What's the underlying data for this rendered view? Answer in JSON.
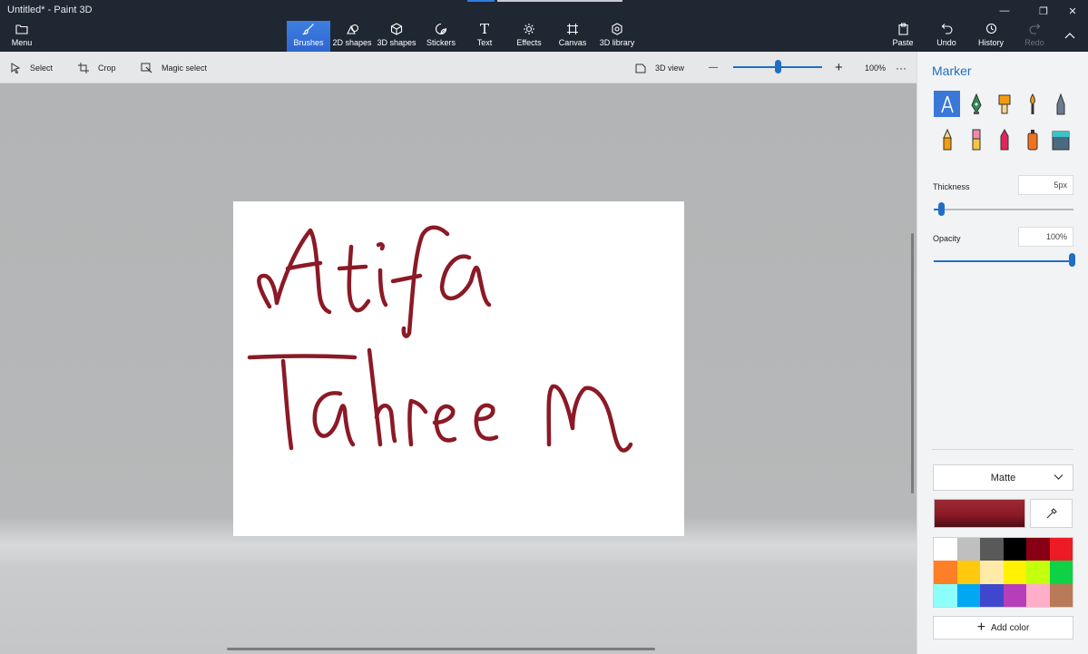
{
  "window": {
    "title": "Untitled* - Paint 3D",
    "minimize_glyph": "—",
    "restore_glyph": "❐",
    "close_glyph": "✕"
  },
  "ribbon": {
    "menu_label": "Menu",
    "tabs": [
      {
        "label": "Brushes",
        "icon": "brush-icon",
        "active": true
      },
      {
        "label": "2D shapes",
        "icon": "2d-shapes-icon"
      },
      {
        "label": "3D shapes",
        "icon": "3d-shapes-icon"
      },
      {
        "label": "Stickers",
        "icon": "stickers-icon"
      },
      {
        "label": "Text",
        "icon": "text-icon",
        "glyph": "T"
      },
      {
        "label": "Effects",
        "icon": "effects-icon"
      },
      {
        "label": "Canvas",
        "icon": "canvas-icon"
      },
      {
        "label": "3D library",
        "icon": "3d-library-icon"
      }
    ],
    "right": [
      {
        "label": "Paste",
        "icon": "paste-icon"
      },
      {
        "label": "Undo",
        "icon": "undo-icon"
      },
      {
        "label": "History",
        "icon": "history-icon"
      },
      {
        "label": "Redo",
        "icon": "redo-icon",
        "disabled": true
      }
    ]
  },
  "toolbar": {
    "select_label": "Select",
    "crop_label": "Crop",
    "magic_select_label": "Magic select",
    "view_3d_label": "3D view",
    "zoom_minus": "—",
    "zoom_plus": "+",
    "zoom_level": "100%",
    "zoom_slider_fraction": 0.5,
    "more_glyph": "···"
  },
  "canvas": {
    "stroke_color": "#8b1a26",
    "drawing_text": [
      "Atifa",
      "Tahreem"
    ]
  },
  "panel": {
    "title": "Marker",
    "brushes": [
      {
        "name": "marker",
        "selected": true
      },
      {
        "name": "calligraphy-pen"
      },
      {
        "name": "oil-brush"
      },
      {
        "name": "watercolor"
      },
      {
        "name": "pixel-pen"
      },
      {
        "name": "pencil"
      },
      {
        "name": "eraser"
      },
      {
        "name": "crayon"
      },
      {
        "name": "spray-can"
      },
      {
        "name": "fill"
      }
    ],
    "thickness_label": "Thickness",
    "thickness_value": "5px",
    "thickness_fraction": 0.05,
    "opacity_label": "Opacity",
    "opacity_value": "100%",
    "opacity_fraction": 1.0,
    "finish_value": "Matte",
    "current_color": "#8c1a26",
    "palette": [
      "#ffffff",
      "#bfbfbf",
      "#595959",
      "#000000",
      "#880015",
      "#ed1c24",
      "#ff7f27",
      "#ffc90e",
      "#ffeaa7",
      "#fff200",
      "#c4ff0e",
      "#0ed145",
      "#8cfffb",
      "#00a8f3",
      "#3f48cc",
      "#b83dba",
      "#ffaec9",
      "#b97a57"
    ],
    "add_color_label": "Add color"
  },
  "colors": {
    "accent": "#1f6fc4",
    "titlebar": "#1f2733"
  }
}
